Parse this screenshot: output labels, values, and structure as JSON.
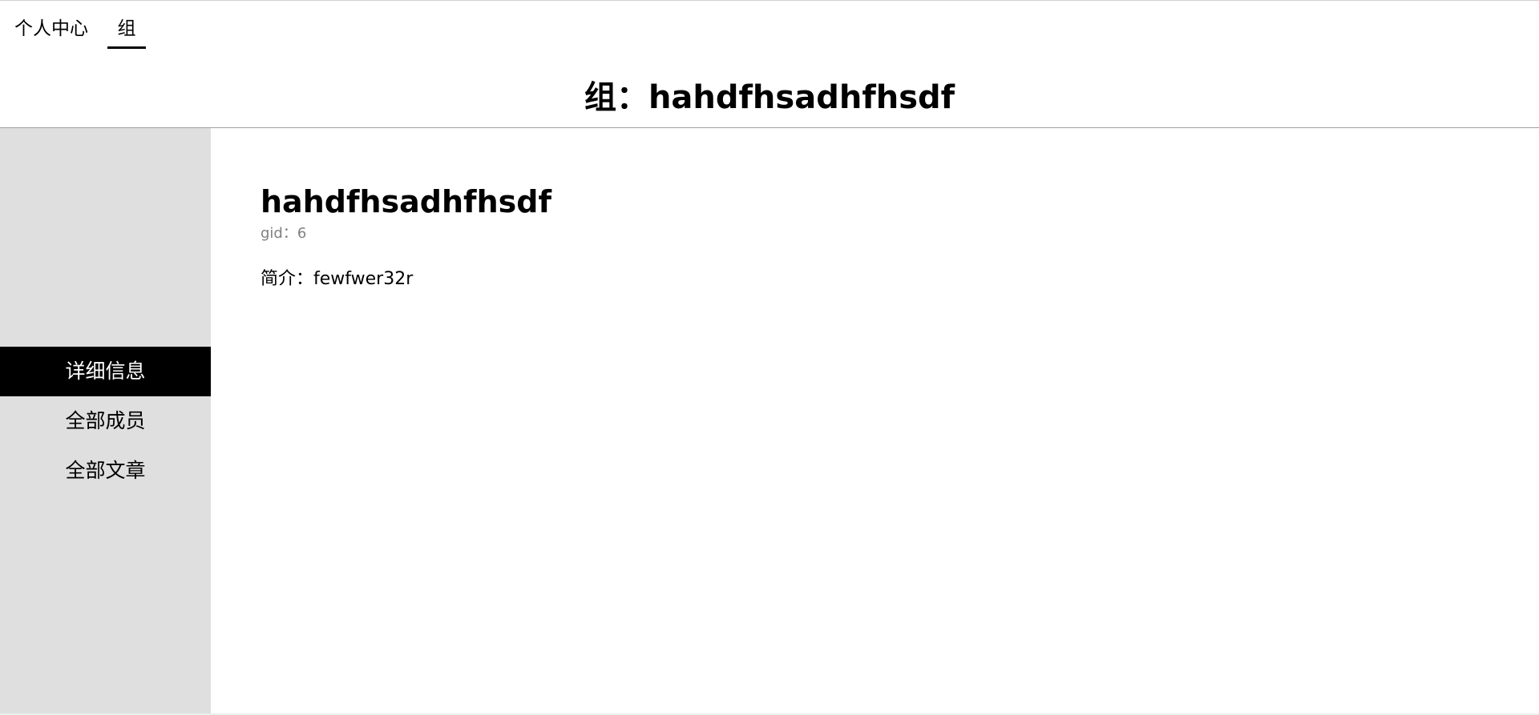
{
  "nav": {
    "tabs": [
      {
        "label": "个人中心"
      },
      {
        "label": "组"
      }
    ]
  },
  "page": {
    "title": "组：hahdfhsadhfhsdf"
  },
  "sidebar": {
    "items": [
      {
        "label": "详细信息",
        "active": true
      },
      {
        "label": "全部成员",
        "active": false
      },
      {
        "label": "全部文章",
        "active": false
      }
    ]
  },
  "group": {
    "name": "hahdfhsadhfhsdf",
    "gid_text": "gid：6",
    "intro_text": "简介：fewfwer32r"
  },
  "colors": {
    "sidebar_bg": "#dfdfdf",
    "active_item_bg": "#000000",
    "active_item_text": "#ffffff",
    "muted_text": "#808080",
    "divider": "#a0a0a0"
  }
}
